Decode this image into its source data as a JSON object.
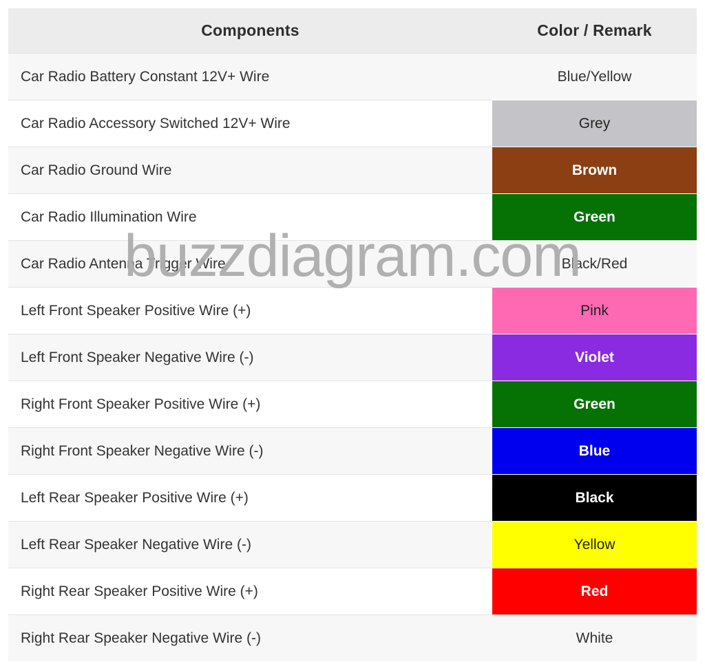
{
  "page": {
    "background": "#ffffff",
    "watermark": {
      "text": "buzzdiagram.com",
      "color": "#adadad"
    }
  },
  "table": {
    "name": "car-radio-wiring-color-table",
    "columns": [
      {
        "key": "components",
        "label": "Components",
        "align": "center"
      },
      {
        "key": "color_remark",
        "label": "Color / Remark",
        "align": "center"
      }
    ],
    "header_background": "#ececec",
    "header_text_color": "#2e2e2e",
    "stripe_background": "#f7f7f7",
    "plain_background": "#ffffff",
    "border_color": "#e4e4e4",
    "rows": [
      {
        "component": "Car Radio Battery Constant 12V+ Wire",
        "color_label": "Blue/Yellow",
        "fill": "none",
        "text_color": "#333333"
      },
      {
        "component": "Car Radio Accessory Switched 12V+ Wire",
        "color_label": "Grey",
        "fill": "#c4c4c8",
        "text_color": "#222222"
      },
      {
        "component": "Car Radio Ground Wire",
        "color_label": "Brown",
        "fill": "#8b3f12",
        "text_color": "#ffffff"
      },
      {
        "component": "Car Radio Illumination Wire",
        "color_label": "Green",
        "fill": "#067206",
        "text_color": "#ffffff"
      },
      {
        "component": "Car Radio Antenna Trigger Wire",
        "color_label": "Black/Red",
        "fill": "none",
        "text_color": "#333333"
      },
      {
        "component": "Left Front Speaker Positive Wire (+)",
        "color_label": "Pink",
        "fill": "#ff69b4",
        "text_color": "#222222"
      },
      {
        "component": "Left Front Speaker Negative Wire (-)",
        "color_label": "Violet",
        "fill": "#8a2be2",
        "text_color": "#ffffff"
      },
      {
        "component": "Right Front Speaker Positive Wire (+)",
        "color_label": "Green",
        "fill": "#067206",
        "text_color": "#ffffff"
      },
      {
        "component": "Right Front Speaker Negative Wire (-)",
        "color_label": "Blue",
        "fill": "#0000ee",
        "text_color": "#ffffff"
      },
      {
        "component": "Left Rear Speaker Positive Wire (+)",
        "color_label": "Black",
        "fill": "#000000",
        "text_color": "#ffffff"
      },
      {
        "component": "Left Rear Speaker Negative Wire (-)",
        "color_label": "Yellow",
        "fill": "#ffff00",
        "text_color": "#222222"
      },
      {
        "component": "Right Rear Speaker Positive Wire (+)",
        "color_label": "Red",
        "fill": "#ff0000",
        "text_color": "#ffffff"
      },
      {
        "component": "Right Rear Speaker Negative Wire (-)",
        "color_label": "White",
        "fill": "none",
        "text_color": "#333333"
      }
    ]
  }
}
